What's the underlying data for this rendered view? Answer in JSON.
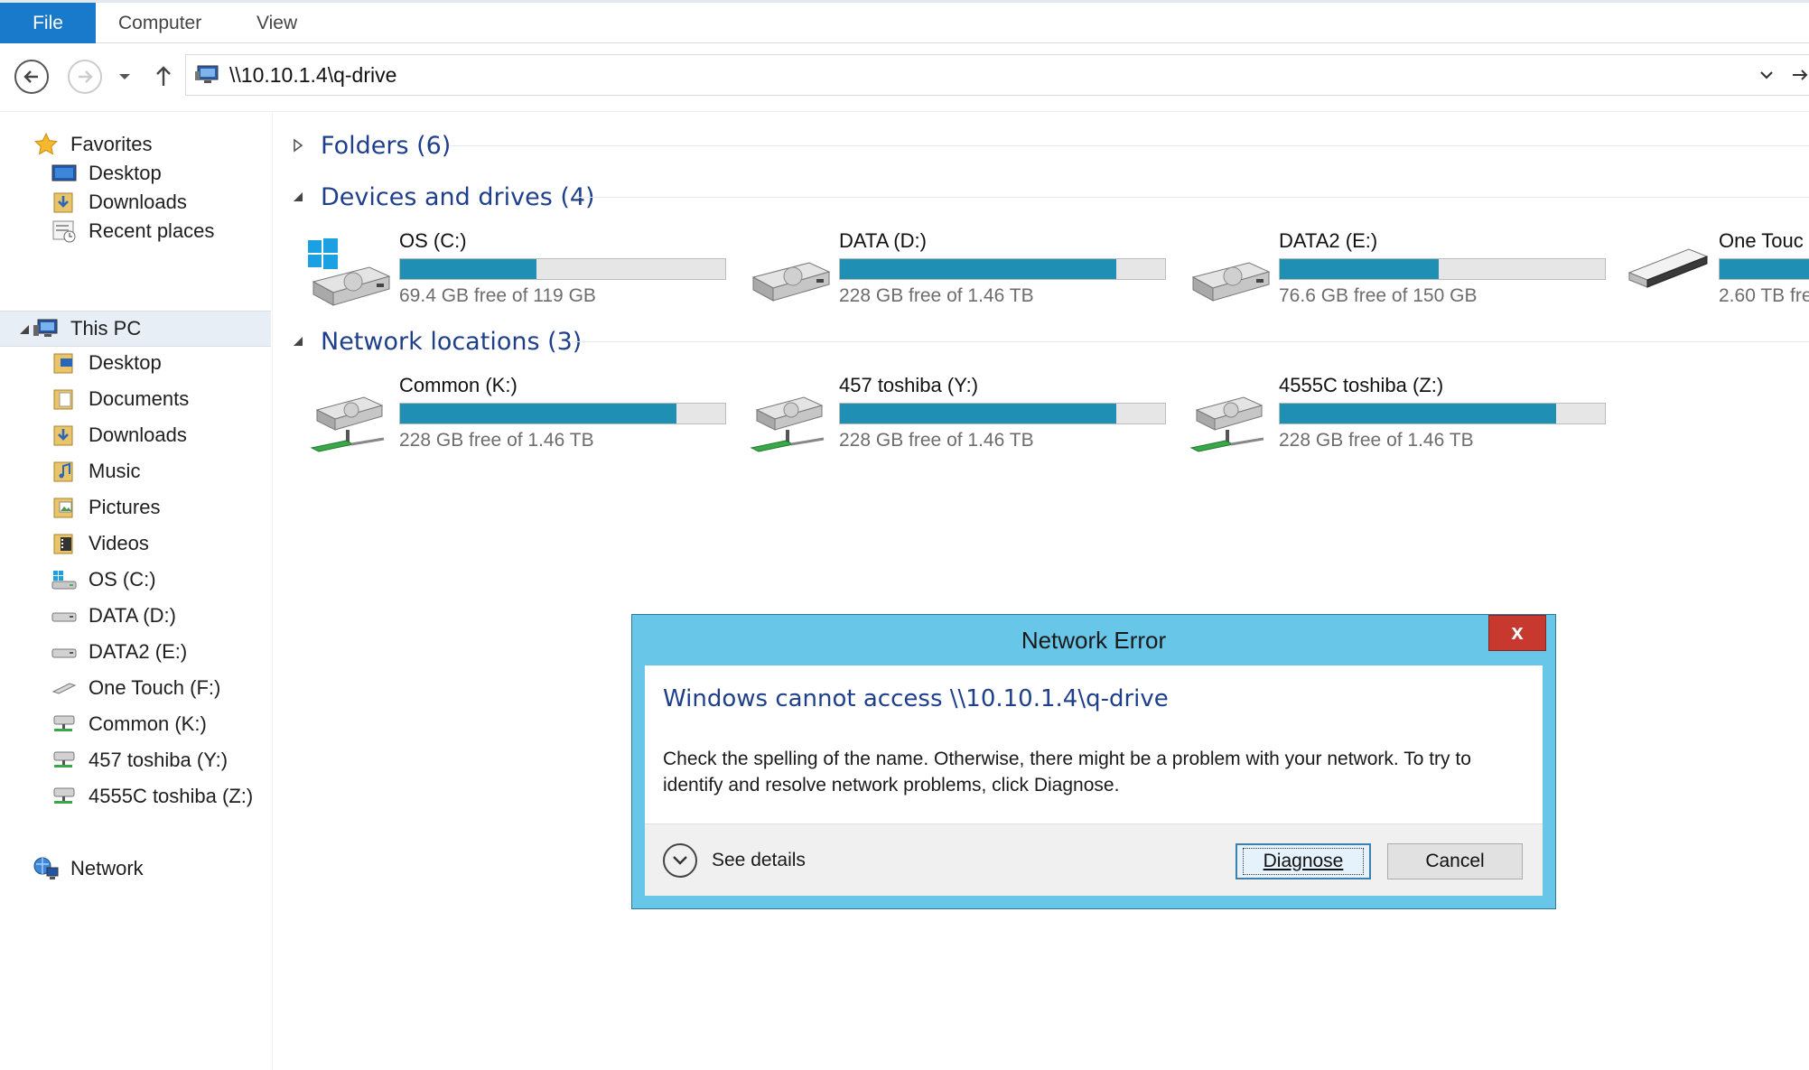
{
  "ribbon": {
    "tabs": [
      {
        "label": "File"
      },
      {
        "label": "Computer"
      },
      {
        "label": "View"
      }
    ]
  },
  "address": {
    "path": "\\\\10.10.1.4\\q-drive"
  },
  "sidebar": {
    "favorites": {
      "label": "Favorites",
      "items": [
        {
          "label": "Desktop"
        },
        {
          "label": "Downloads"
        },
        {
          "label": "Recent places"
        }
      ]
    },
    "this_pc": {
      "label": "This PC",
      "items": [
        {
          "label": "Desktop"
        },
        {
          "label": "Documents"
        },
        {
          "label": "Downloads"
        },
        {
          "label": "Music"
        },
        {
          "label": "Pictures"
        },
        {
          "label": "Videos"
        },
        {
          "label": "OS (C:)"
        },
        {
          "label": "DATA (D:)"
        },
        {
          "label": "DATA2 (E:)"
        },
        {
          "label": "One Touch (F:)"
        },
        {
          "label": "Common (K:)"
        },
        {
          "label": "457 toshiba (Y:)"
        },
        {
          "label": "4555C toshiba (Z:)"
        }
      ]
    },
    "network": {
      "label": "Network"
    }
  },
  "content": {
    "folders_header": "Folders (6)",
    "devices_header": "Devices and drives (4)",
    "network_header": "Network locations (3)",
    "devices": [
      {
        "name": "OS (C:)",
        "free": "69.4 GB free of 119 GB",
        "used_fraction": 0.42
      },
      {
        "name": "DATA (D:)",
        "free": "228 GB free of 1.46 TB",
        "used_fraction": 0.85
      },
      {
        "name": "DATA2 (E:)",
        "free": "76.6 GB free of 150 GB",
        "used_fraction": 0.49
      },
      {
        "name": "One Touc",
        "free": "2.60 TB fre",
        "used_fraction": 0.9
      }
    ],
    "network_drives": [
      {
        "name": "Common (K:)",
        "free": "228 GB free of 1.46 TB",
        "used_fraction": 0.85
      },
      {
        "name": "457 toshiba (Y:)",
        "free": "228 GB free of 1.46 TB",
        "used_fraction": 0.85
      },
      {
        "name": "4555C toshiba (Z:)",
        "free": "228 GB free of 1.46 TB",
        "used_fraction": 0.85
      }
    ]
  },
  "dialog": {
    "title": "Network Error",
    "close_glyph": "x",
    "heading": "Windows cannot access \\\\10.10.1.4\\q-drive",
    "message": "Check the spelling of the name. Otherwise, there might be a problem with your network. To try to identify and resolve network problems, click Diagnose.",
    "see_details": "See details",
    "diagnose_label": "Diagnose",
    "cancel_label": "Cancel"
  },
  "colors": {
    "accent": "#1979ca",
    "group_header": "#1e3f8b",
    "dialog_frame": "#68c6e8",
    "close_button": "#c7392f",
    "usage_bar": "#1f8fb4"
  }
}
